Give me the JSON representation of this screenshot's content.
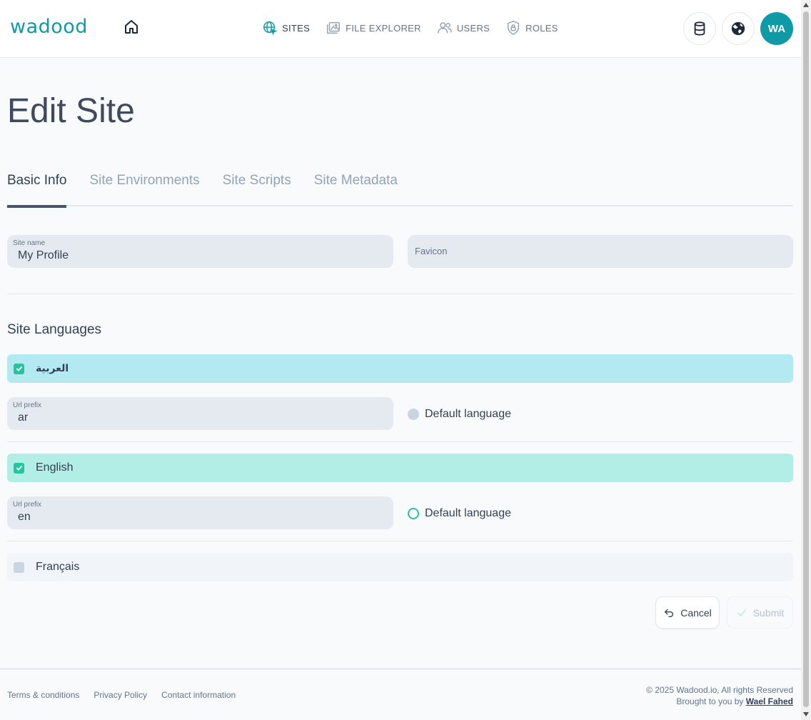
{
  "header": {
    "logo": "wadood",
    "nav": [
      {
        "label": "SITES",
        "icon": "globe-cursor-icon",
        "active": true
      },
      {
        "label": "FILE EXPLORER",
        "icon": "folder-image-icon",
        "active": false
      },
      {
        "label": "USERS",
        "icon": "users-icon",
        "active": false
      },
      {
        "label": "ROLES",
        "icon": "shield-lock-icon",
        "active": false
      }
    ],
    "avatar_initials": "WA"
  },
  "page": {
    "title": "Edit Site"
  },
  "tabs": [
    {
      "label": "Basic Info",
      "active": true
    },
    {
      "label": "Site Environments",
      "active": false
    },
    {
      "label": "Site Scripts",
      "active": false
    },
    {
      "label": "Site Metadata",
      "active": false
    }
  ],
  "basic_info": {
    "site_name_label": "Site name",
    "site_name_value": "My Profile",
    "favicon_label": "Favicon"
  },
  "languages": {
    "title": "Site Languages",
    "url_prefix_label": "Url prefix",
    "default_language_label": "Default language",
    "items": [
      {
        "name": "العربية",
        "checked": true,
        "url_prefix": "ar",
        "bar_color": "#b3eaf2"
      },
      {
        "name": "English",
        "checked": true,
        "url_prefix": "en",
        "bar_color": "#b3eee6"
      },
      {
        "name": "Français",
        "checked": false,
        "bar_color": "#f1f5f9"
      }
    ]
  },
  "actions": {
    "cancel_label": "Cancel",
    "submit_label": "Submit"
  },
  "footer": {
    "links": [
      "Terms & conditions",
      "Privacy Policy",
      "Contact information"
    ],
    "copyright": "© 2025 Wadood.io, All rights Reserved",
    "brought_by_prefix": "Brought to you by",
    "author": "Wael Fahed"
  },
  "colors": {
    "brand": "#0e9aa7",
    "accent_green": "#22c5a0"
  }
}
